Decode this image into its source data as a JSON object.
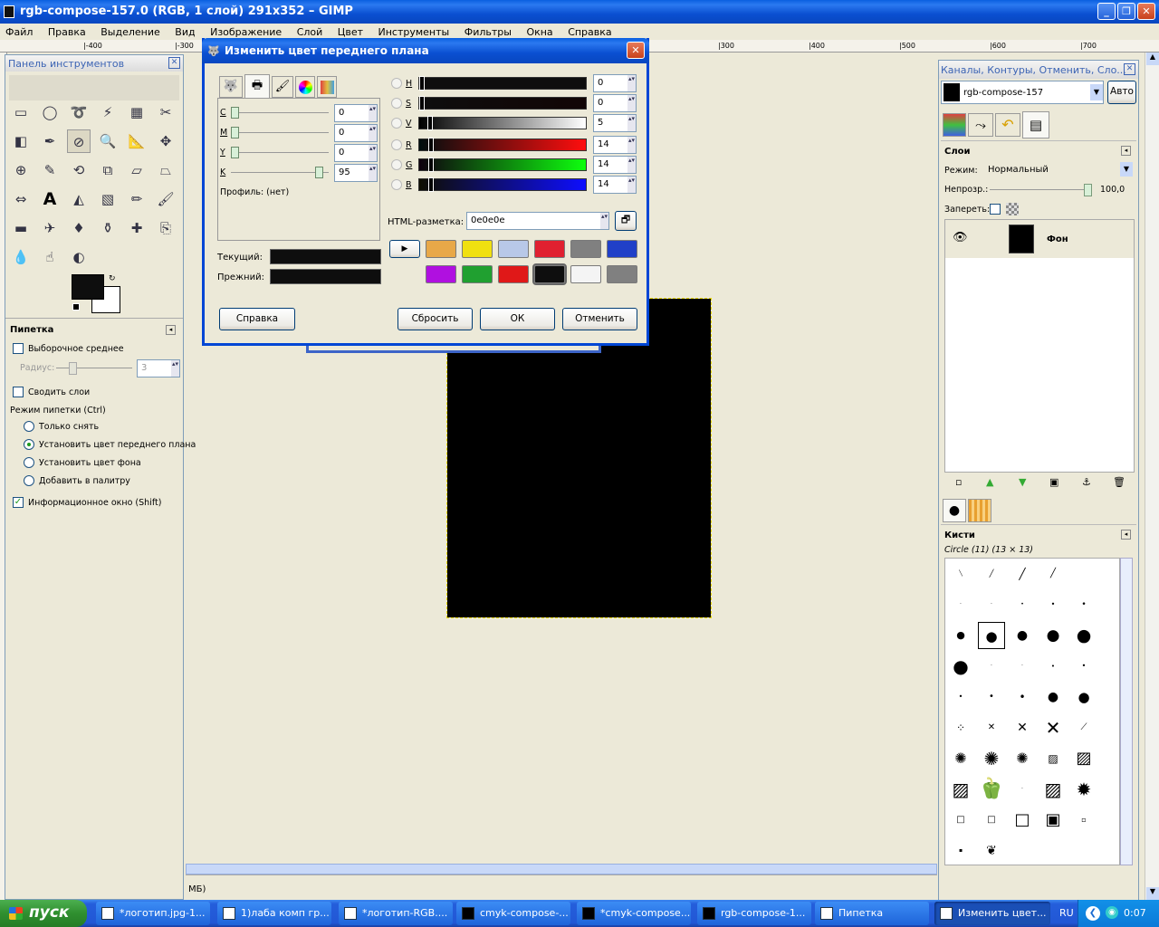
{
  "main_window": {
    "title": "rgb-compose-157.0 (RGB, 1 слой) 291x352 – GIMP",
    "menu": [
      "Файл",
      "Правка",
      "Выделение",
      "Вид",
      "Изображение",
      "Слой",
      "Цвет",
      "Инструменты",
      "Фильтры",
      "Окна",
      "Справка"
    ],
    "ruler_labels": [
      "|-400",
      "|-300",
      "|300",
      "|400",
      "|500",
      "|600",
      "|700"
    ],
    "status_text": "МБ)"
  },
  "toolbox": {
    "title": "Панель инструментов",
    "tool_icons": [
      "rect-select-icon",
      "ellipse-select-icon",
      "lasso-icon",
      "fuzzy-select-icon",
      "color-select-icon",
      "scissors-icon",
      "foreground-select-icon",
      "paths-icon",
      "color-picker-icon",
      "zoom-icon",
      "measure-icon",
      "move-icon",
      "align-icon",
      "crop-icon",
      "rotate-icon",
      "scale-icon",
      "shear-icon",
      "perspective-icon",
      "flip-icon",
      "text-icon",
      "bucket-fill-icon",
      "blend-icon",
      "pencil-icon",
      "paintbrush-icon",
      "eraser-icon",
      "airbrush-icon",
      "ink-icon",
      "clone-icon",
      "heal-icon",
      "perspective-clone-icon",
      "blur-icon",
      "smudge-icon",
      "dodge-icon"
    ],
    "options_title": "Пипетка",
    "sample_average": "Выборочное среднее",
    "radius_label": "Радиус:",
    "radius_value": "3",
    "sample_merged": "Сводить слои",
    "pick_mode_label": "Режим пипетки (Ctrl)",
    "pick_modes": [
      "Только снять",
      "Установить цвет переднего плана",
      "Установить цвет фона",
      "Добавить в палитру"
    ],
    "pick_mode_selected": 1,
    "info_window": "Информационное окно (Shift)"
  },
  "dialog": {
    "title": "Изменить цвет переднего плана",
    "cmyk": [
      {
        "label": "C",
        "value": "0",
        "fraction": 0
      },
      {
        "label": "M",
        "value": "0",
        "fraction": 0
      },
      {
        "label": "Y",
        "value": "0",
        "fraction": 0
      },
      {
        "label": "K",
        "value": "95",
        "fraction": 0.95
      }
    ],
    "profile": "Профиль: (нет)",
    "channels": [
      {
        "label": "H",
        "value": "0",
        "fraction": 0,
        "gradient": "linear-gradient(90deg,#0e0e0e,#0e0e0e)"
      },
      {
        "label": "S",
        "value": "0",
        "fraction": 0,
        "gradient": "linear-gradient(90deg,#0e0e0e,#110505)"
      },
      {
        "label": "V",
        "value": "5",
        "fraction": 0.05,
        "gradient": "linear-gradient(90deg,#000,#fff)"
      },
      {
        "label": "R",
        "value": "14",
        "fraction": 0.055,
        "gradient": "linear-gradient(90deg,#000e0e,#ff0e0e)"
      },
      {
        "label": "G",
        "value": "14",
        "fraction": 0.055,
        "gradient": "linear-gradient(90deg,#0e000e,#0eff0e)"
      },
      {
        "label": "B",
        "value": "14",
        "fraction": 0.055,
        "gradient": "linear-gradient(90deg,#0e0e00,#0e0eff)"
      }
    ],
    "hex_label": "HTML-разметка:",
    "hex_value": "0e0e0e",
    "current_label": "Текущий:",
    "previous_label": "Прежний:",
    "current_color": "#0e0e0e",
    "previous_color": "#0e0e0e",
    "swatches": [
      "#e8a848",
      "#f0e010",
      "#b8c8e8",
      "#e02030",
      "#808080",
      "#2040c8",
      "#b010e0",
      "#20a030",
      "#e01818",
      "#0e0e0e",
      "#f4f4f4",
      "#808080"
    ],
    "help": "Справка",
    "reset": "Сбросить",
    "ok": "ОК",
    "cancel": "Отменить"
  },
  "right_dock": {
    "title": "Каналы, Контуры, Отменить, Сло...",
    "image_name": "rgb-compose-157",
    "auto_button": "Авто",
    "layers_title": "Слои",
    "mode_label": "Режим:",
    "mode_value": "Нормальный",
    "opacity_label": "Непрозр.:",
    "opacity_value": "100,0",
    "lock_label": "Запереть:",
    "layer_name": "Фон",
    "brushes_title": "Кисти",
    "brush_current": "Circle (11) (13 × 13)"
  },
  "taskbar": {
    "start": "пуск",
    "items": [
      "*логотип.jpg-1...",
      "1)лаба комп гр...",
      "*логотип-RGB....",
      "cmyk-compose-...",
      "*cmyk-compose...",
      "rgb-compose-1...",
      "Пипетка",
      "Изменить цвет..."
    ],
    "lang": "RU",
    "clock": "0:07"
  },
  "colors": {
    "accent": "#0a5fe0",
    "canvas": "#000000",
    "dialog_border": "#0046d5"
  }
}
